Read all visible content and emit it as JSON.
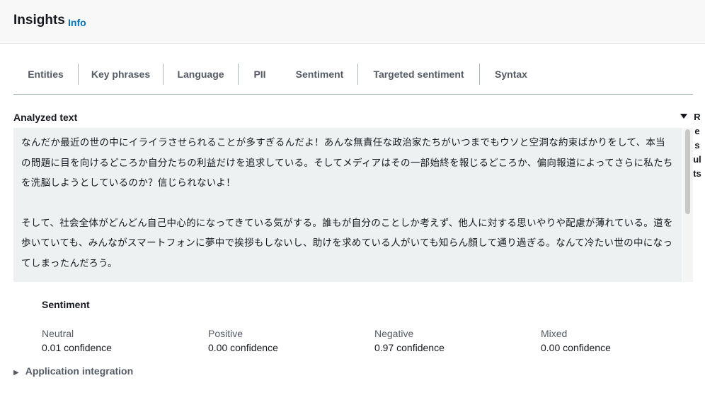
{
  "header": {
    "title": "Insights",
    "info_link": "Info"
  },
  "tabs": [
    {
      "label": "Entities"
    },
    {
      "label": "Key phrases"
    },
    {
      "label": "Language"
    },
    {
      "label": "PII"
    },
    {
      "label": "Sentiment"
    },
    {
      "label": "Targeted sentiment"
    },
    {
      "label": "Syntax"
    }
  ],
  "active_tab": "Sentiment",
  "analyzed_text": {
    "label": "Analyzed text",
    "paragraphs": [
      "なんだか最近の世の中にイライラさせられることが多すぎるんだよ！あんな無責任な政治家たちがいつまでもウソと空洞な約束ばかりをして、本当の問題に目を向けるどころか自分たちの利益だけを追求している。そしてメディアはその一部始終を報じるどころか、偏向報道によってさらに私たちを洗脳しようとしているのか？信じられないよ！",
      "そして、社会全体がどんどん自己中心的になってきている気がする。誰もが自分のことしか考えず、他人に対する思いやりや配慮が薄れている。道を歩いていても、みんながスマートフォンに夢中で挨拶もしないし、助けを求めている人がいても知らん顔して通り過ぎる。なんて冷たい世の中になってしまったんだろう。"
    ]
  },
  "results_panel": {
    "label": "Results",
    "toggle_icon": "caret-down-icon"
  },
  "sentiment": {
    "title": "Sentiment",
    "metrics": [
      {
        "name": "Neutral",
        "value": "0.01 confidence"
      },
      {
        "name": "Positive",
        "value": "0.00 confidence"
      },
      {
        "name": "Negative",
        "value": "0.97 confidence"
      },
      {
        "name": "Mixed",
        "value": "0.00 confidence"
      }
    ]
  },
  "application_integration": {
    "label": "Application integration",
    "icon": "caret-right-icon"
  },
  "colors": {
    "link": "#0073bb",
    "active_underline": "#16191f",
    "text_area_bg": "#eef1f1"
  }
}
